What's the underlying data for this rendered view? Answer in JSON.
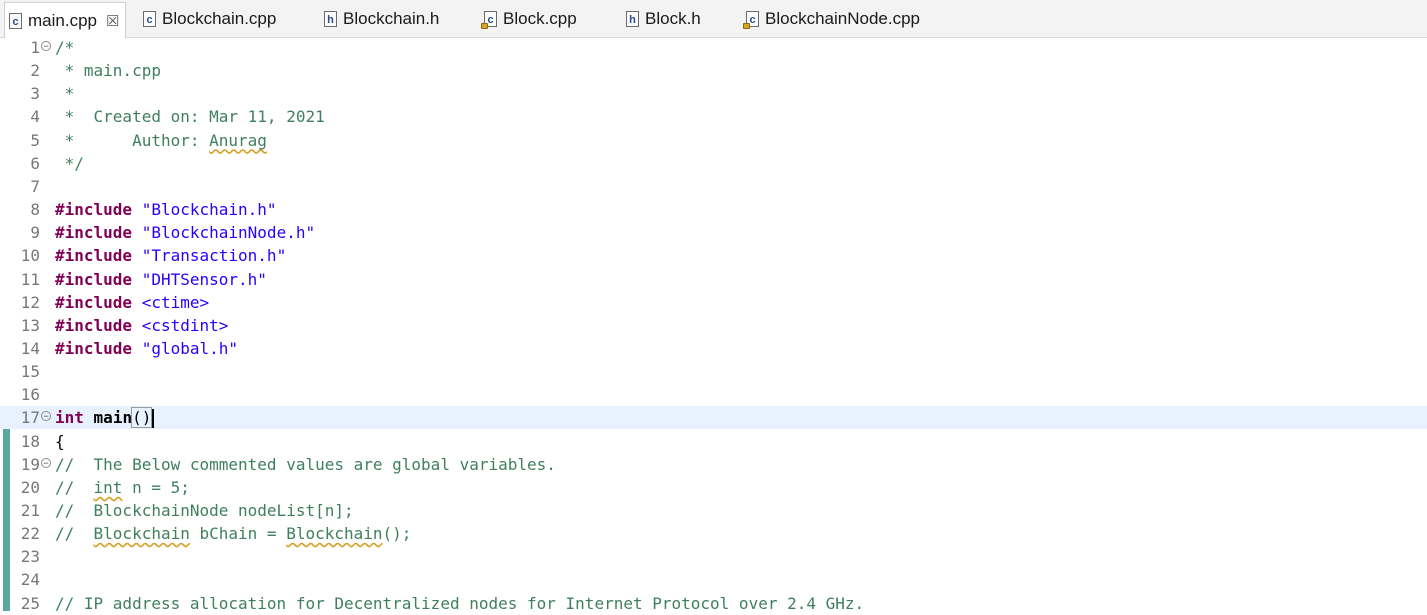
{
  "tabs": [
    {
      "label": "main.cpp",
      "icon": "c-source-file-icon",
      "active": true,
      "close": "☒"
    },
    {
      "label": "Blockchain.cpp",
      "icon": "c-source-file-icon",
      "active": false
    },
    {
      "label": "Blockchain.h",
      "icon": "header-file-icon",
      "active": false
    },
    {
      "label": "Block.cpp",
      "icon": "c-source-file-locked-icon",
      "active": false
    },
    {
      "label": "Block.h",
      "icon": "header-file-icon",
      "active": false
    },
    {
      "label": "BlockchainNode.cpp",
      "icon": "c-source-file-locked-icon",
      "active": false
    }
  ],
  "editor": {
    "current_line": 17,
    "lines": [
      {
        "n": "1",
        "fold": true,
        "segs": [
          {
            "t": "/*",
            "c": "cmt"
          }
        ]
      },
      {
        "n": "2",
        "segs": [
          {
            "t": " * main.cpp",
            "c": "cmt"
          }
        ]
      },
      {
        "n": "3",
        "segs": [
          {
            "t": " *",
            "c": "cmt"
          }
        ]
      },
      {
        "n": "4",
        "segs": [
          {
            "t": " *  Created on: Mar 11, 2021",
            "c": "cmt"
          }
        ]
      },
      {
        "n": "5",
        "segs": [
          {
            "t": " *      Author: ",
            "c": "cmt"
          },
          {
            "t": "Anurag",
            "c": "cmt squig"
          }
        ]
      },
      {
        "n": "6",
        "segs": [
          {
            "t": " */",
            "c": "cmt"
          }
        ]
      },
      {
        "n": "7",
        "segs": []
      },
      {
        "n": "8",
        "segs": [
          {
            "t": "#include",
            "c": "kw"
          },
          {
            "t": " ",
            "c": "plain"
          },
          {
            "t": "\"Blockchain.h\"",
            "c": "str"
          }
        ]
      },
      {
        "n": "9",
        "segs": [
          {
            "t": "#include",
            "c": "kw"
          },
          {
            "t": " ",
            "c": "plain"
          },
          {
            "t": "\"BlockchainNode.h\"",
            "c": "str"
          }
        ]
      },
      {
        "n": "10",
        "segs": [
          {
            "t": "#include",
            "c": "kw"
          },
          {
            "t": " ",
            "c": "plain"
          },
          {
            "t": "\"Transaction.h\"",
            "c": "str"
          }
        ]
      },
      {
        "n": "11",
        "segs": [
          {
            "t": "#include",
            "c": "kw"
          },
          {
            "t": " ",
            "c": "plain"
          },
          {
            "t": "\"DHTSensor.h\"",
            "c": "str"
          }
        ]
      },
      {
        "n": "12",
        "segs": [
          {
            "t": "#include",
            "c": "kw"
          },
          {
            "t": " ",
            "c": "plain"
          },
          {
            "t": "<ctime>",
            "c": "str"
          }
        ]
      },
      {
        "n": "13",
        "segs": [
          {
            "t": "#include",
            "c": "kw"
          },
          {
            "t": " ",
            "c": "plain"
          },
          {
            "t": "<cstdint>",
            "c": "str"
          }
        ]
      },
      {
        "n": "14",
        "segs": [
          {
            "t": "#include",
            "c": "kw"
          },
          {
            "t": " ",
            "c": "plain"
          },
          {
            "t": "\"global.h\"",
            "c": "str"
          }
        ]
      },
      {
        "n": "15",
        "segs": []
      },
      {
        "n": "16",
        "segs": []
      },
      {
        "n": "17",
        "fold": true,
        "caret": true,
        "segs": [
          {
            "t": "int",
            "c": "kw"
          },
          {
            "t": " ",
            "c": "plain"
          },
          {
            "t": "main",
            "c": "plain bold"
          },
          {
            "t": "()",
            "c": "plain paren-box"
          }
        ]
      },
      {
        "n": "18",
        "segs": [
          {
            "t": "{",
            "c": "plain"
          }
        ]
      },
      {
        "n": "19",
        "fold": true,
        "segs": [
          {
            "t": "//  The Below commented values are global variables.",
            "c": "cmt"
          }
        ]
      },
      {
        "n": "20",
        "segs": [
          {
            "t": "//  ",
            "c": "cmt"
          },
          {
            "t": "int",
            "c": "cmt squig"
          },
          {
            "t": " n = 5;",
            "c": "cmt"
          }
        ]
      },
      {
        "n": "21",
        "segs": [
          {
            "t": "//  BlockchainNode nodeList[n];",
            "c": "cmt"
          }
        ]
      },
      {
        "n": "22",
        "segs": [
          {
            "t": "//  ",
            "c": "cmt"
          },
          {
            "t": "Blockchain",
            "c": "cmt squig"
          },
          {
            "t": " bChain = ",
            "c": "cmt"
          },
          {
            "t": "Blockchain",
            "c": "cmt squig"
          },
          {
            "t": "();",
            "c": "cmt"
          }
        ]
      },
      {
        "n": "23",
        "segs": []
      },
      {
        "n": "24",
        "segs": []
      },
      {
        "n": "25",
        "segs": [
          {
            "t": "// IP address allocation for Decentralized nodes for Internet Protocol over 2.4 GHz.",
            "c": "cmt"
          }
        ]
      }
    ]
  }
}
